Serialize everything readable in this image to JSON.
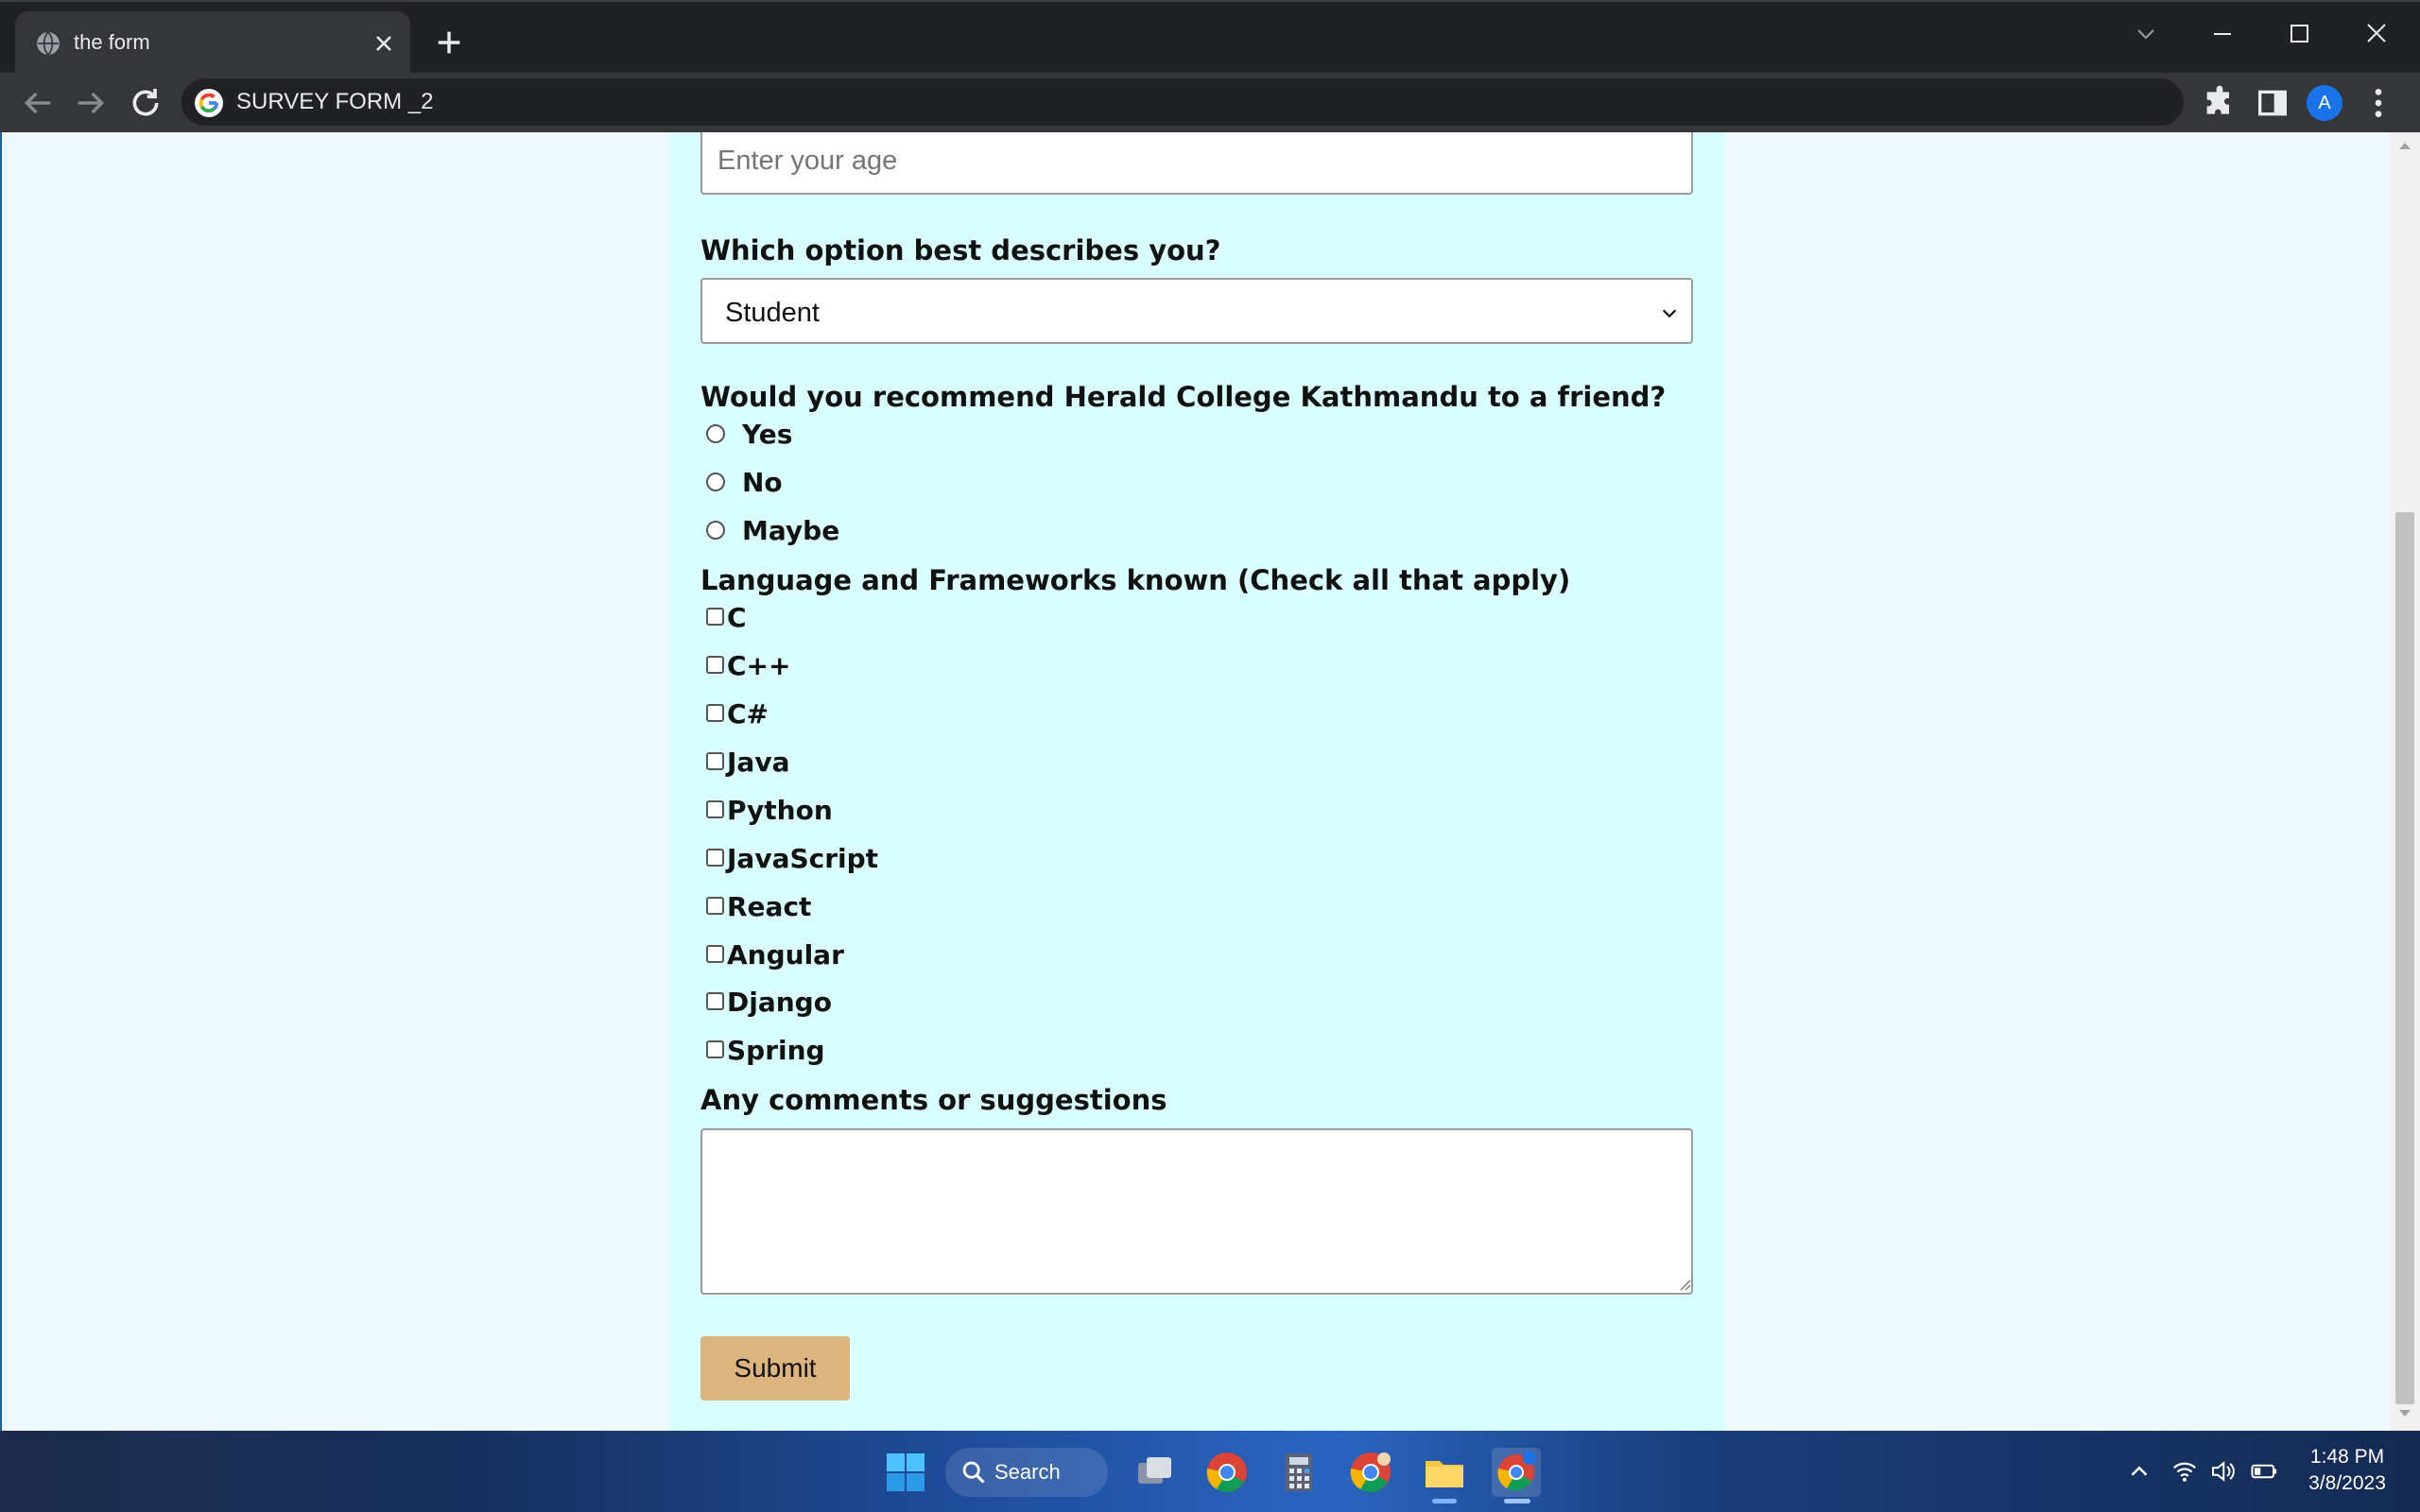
{
  "browser": {
    "tab_title": "the form",
    "address": "SURVEY FORM _2",
    "profile_initial": "A"
  },
  "form": {
    "age_placeholder": "Enter your age",
    "role_label": "Which option best describes you?",
    "role_selected": "Student",
    "recommend_label": "Would you recommend Herald College Kathmandu to a friend?",
    "recommend_options": [
      "Yes",
      "No",
      "Maybe"
    ],
    "languages_label": "Language and Frameworks known (Check all that apply)",
    "languages": [
      "C",
      "C++",
      "C#",
      "Java",
      "Python",
      "JavaScript",
      "React",
      "Angular",
      "Django",
      "Spring"
    ],
    "comments_label": "Any comments or suggestions",
    "submit_label": "Submit"
  },
  "taskbar": {
    "search_label": "Search",
    "time": "1:48 PM",
    "date": "3/8/2023"
  },
  "colors": {
    "form_background": "#d9ffff",
    "page_background": "#f0f8ff",
    "submit_button": "#dcb47e"
  }
}
